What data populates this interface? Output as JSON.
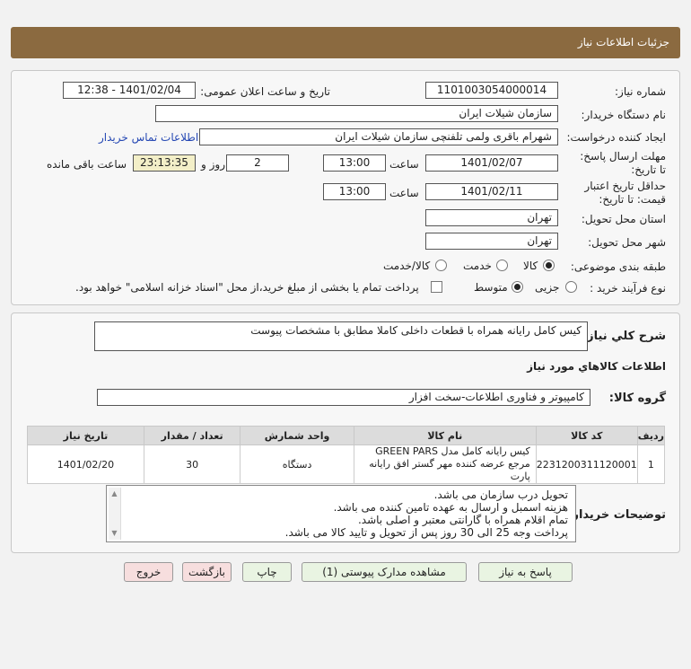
{
  "header": {
    "title": "جزئیات اطلاعات نیاز"
  },
  "form": {
    "need_number_label": "شماره نیاز:",
    "need_number": "1101003054000014",
    "announce_label": "تاریخ و ساعت اعلان عمومی:",
    "announce_value": "1401/02/04 - 12:38",
    "buyer_org_label": "نام دستگاه خریدار:",
    "buyer_org": "سازمان شیلات ایران",
    "requester_label": "ایجاد کننده درخواست:",
    "requester": "شهرام باقری ولمی تلفنچی سازمان شیلات ایران",
    "contact_link": "اطلاعات تماس خریدار",
    "reply_deadline_label": "مهلت ارسال پاسخ: تا تاریخ:",
    "reply_date": "1401/02/07",
    "time_label": "ساعت",
    "reply_time": "13:00",
    "days_value": "2",
    "days_label": "روز و",
    "remaining_time": "23:13:35",
    "remaining_label": "ساعت باقی مانده",
    "validity_label": "حداقل تاریخ اعتبار قیمت: تا تاریخ:",
    "validity_date": "1401/02/11",
    "validity_time": "13:00",
    "province_label": "استان محل تحویل:",
    "province": "تهران",
    "city_label": "شهر محل تحویل:",
    "city": "تهران",
    "category_label": "طبقه بندی موضوعی:",
    "category_options": [
      "کالا",
      "خدمت",
      "کالا/خدمت"
    ],
    "process_label": "نوع فرآیند خرید :",
    "process_options": [
      "جزیی",
      "متوسط"
    ],
    "payment_note": "پرداخت تمام یا بخشی از مبلغ خرید،از محل \"اسناد خزانه اسلامی\" خواهد بود."
  },
  "summary": {
    "label": "شرح کلي نياز:",
    "value": "کیس کامل رایانه همراه با قطعات داخلی کاملا مطابق با مشخصات پیوست"
  },
  "goods": {
    "section_title": "اطلاعات کالاهاي مورد نياز",
    "group_label": "گروه کالا:",
    "group_value": "کامپیوتر و فناوری اطلاعات-سخت افزار",
    "columns": [
      "ردیف",
      "کد کالا",
      "نام کالا",
      "واحد شمارش",
      "تعداد / مقدار",
      "تاریخ نیاز"
    ],
    "rows": [
      {
        "row": "1",
        "code": "2231200311120001",
        "name": "کیس رایانه کامل مدل GREEN PARS مرجع عرضه کننده مهر گستر افق رایانه پارت",
        "unit": "دستگاه",
        "qty": "30",
        "date": "1401/02/20"
      }
    ]
  },
  "notes": {
    "label": "توضیحات خریدار:",
    "lines": [
      "تحویل درب سازمان می باشد.",
      "هزینه اسمبل و ارسال به عهده تامین کننده می باشد.",
      "تمام اقلام همراه با گارانتی معتبر و اصلی باشد.",
      "پرداخت وجه 25 الی 30 روز پس از تحویل و تایید کالا می باشد."
    ]
  },
  "buttons": {
    "reply": "پاسخ به نیاز",
    "attachments": "مشاهده مدارک پیوستی (1)",
    "print": "چاپ",
    "back": "بازگشت",
    "exit": "خروج"
  },
  "colors": {
    "header": "#8b6a40",
    "button_green": "#e9f4e2",
    "button_red": "#f7dede",
    "link": "#2447b3"
  }
}
